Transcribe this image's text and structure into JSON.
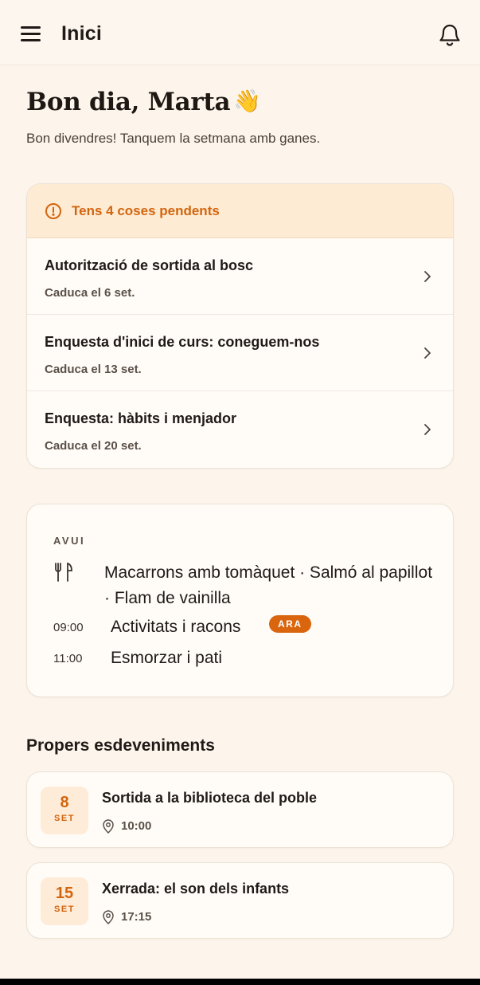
{
  "header": {
    "title": "Inici"
  },
  "greeting": {
    "title": "Bon dia, Marta",
    "emoji": "👋",
    "subtitle": "Bon divendres! Tanquem la setmana amb ganes."
  },
  "pending": {
    "title": "Tens 4 coses pendents",
    "items": [
      {
        "title": "Autorització de sortida al bosc",
        "due": "Caduca el 6 set."
      },
      {
        "title": "Enquesta d'inici de curs: coneguem-nos",
        "due": "Caduca el 13 set."
      },
      {
        "title": "Enquesta: hàbits i menjador",
        "due": "Caduca el 20 set."
      }
    ]
  },
  "today": {
    "label": "AVUI",
    "menu": "Macarrons amb tomàquet · Salmó al papillot · Flam de vainilla",
    "schedule": [
      {
        "time": "09:00",
        "activity": "Activitats i racons",
        "badge": "ARA"
      },
      {
        "time": "11:00",
        "activity": "Esmorzar i pati"
      }
    ]
  },
  "events": {
    "heading": "Propers esdeveniments",
    "items": [
      {
        "day": "8",
        "month": "SET",
        "title": "Sortida a la biblioteca del poble",
        "time": "10:00"
      },
      {
        "day": "15",
        "month": "SET",
        "title": "Xerrada: el son dels infants",
        "time": "17:15"
      }
    ]
  },
  "colors": {
    "accent": "#d2650f",
    "background": "#fdf5ec",
    "alert_bg": "#feebd3"
  },
  "icons": [
    "menu-icon",
    "bell-icon",
    "alert-icon",
    "chevron-right-icon",
    "fork-knife-icon",
    "location-pin-icon"
  ]
}
